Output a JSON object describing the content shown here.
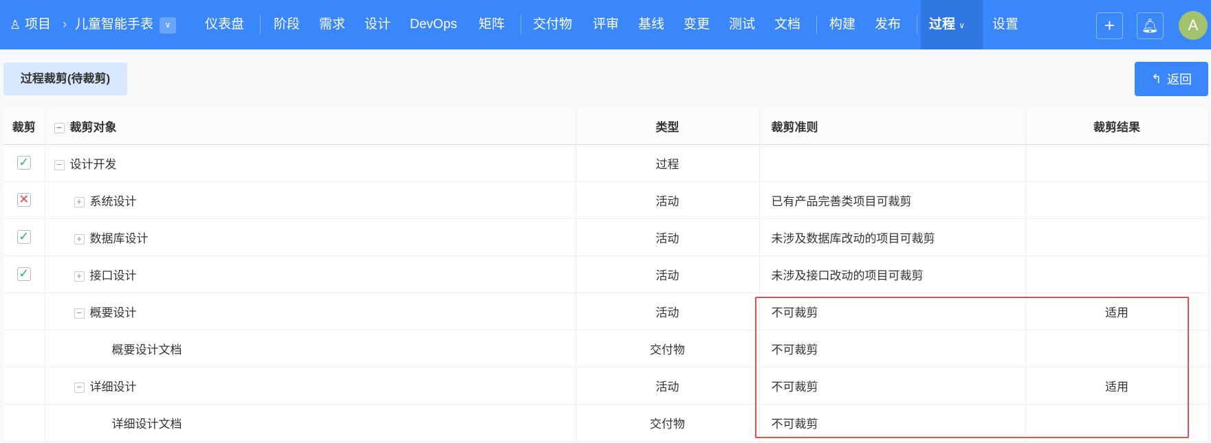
{
  "nav": {
    "breadcrumb_root": "项目",
    "project": "儿童智能手表",
    "items": [
      "仪表盘",
      "阶段",
      "需求",
      "设计",
      "DevOps",
      "矩阵",
      "交付物",
      "评审",
      "基线",
      "变更",
      "测试",
      "文档",
      "构建",
      "发布"
    ],
    "active": "过程",
    "settings": "设置",
    "avatar": "A"
  },
  "toolbar": {
    "tag": "过程裁剪(待裁剪)",
    "back": "返回"
  },
  "table": {
    "headers": [
      "裁剪",
      "裁剪对象",
      "类型",
      "裁剪准则",
      "裁剪结果"
    ],
    "rows": [
      {
        "check": "yes",
        "toggle": "−",
        "level": 0,
        "name": "设计开发",
        "type": "过程",
        "rule": "",
        "result": ""
      },
      {
        "check": "no",
        "toggle": "+",
        "level": 1,
        "name": "系统设计",
        "type": "活动",
        "rule": "已有产品完善类项目可裁剪",
        "result": ""
      },
      {
        "check": "yes",
        "toggle": "+",
        "level": 1,
        "name": "数据库设计",
        "type": "活动",
        "rule": "未涉及数据库改动的项目可裁剪",
        "result": ""
      },
      {
        "check": "yes",
        "toggle": "+",
        "level": 1,
        "name": "接口设计",
        "type": "活动",
        "rule": "未涉及接口改动的项目可裁剪",
        "result": ""
      },
      {
        "check": "",
        "toggle": "−",
        "level": 1,
        "name": "概要设计",
        "type": "活动",
        "rule": "不可裁剪",
        "result": "适用"
      },
      {
        "check": "",
        "toggle": "",
        "level": 2,
        "name": "概要设计文档",
        "type": "交付物",
        "rule": "不可裁剪",
        "result": ""
      },
      {
        "check": "",
        "toggle": "−",
        "level": 1,
        "name": "详细设计",
        "type": "活动",
        "rule": "不可裁剪",
        "result": "适用"
      },
      {
        "check": "",
        "toggle": "",
        "level": 2,
        "name": "详细设计文档",
        "type": "交付物",
        "rule": "不可裁剪",
        "result": ""
      }
    ]
  }
}
